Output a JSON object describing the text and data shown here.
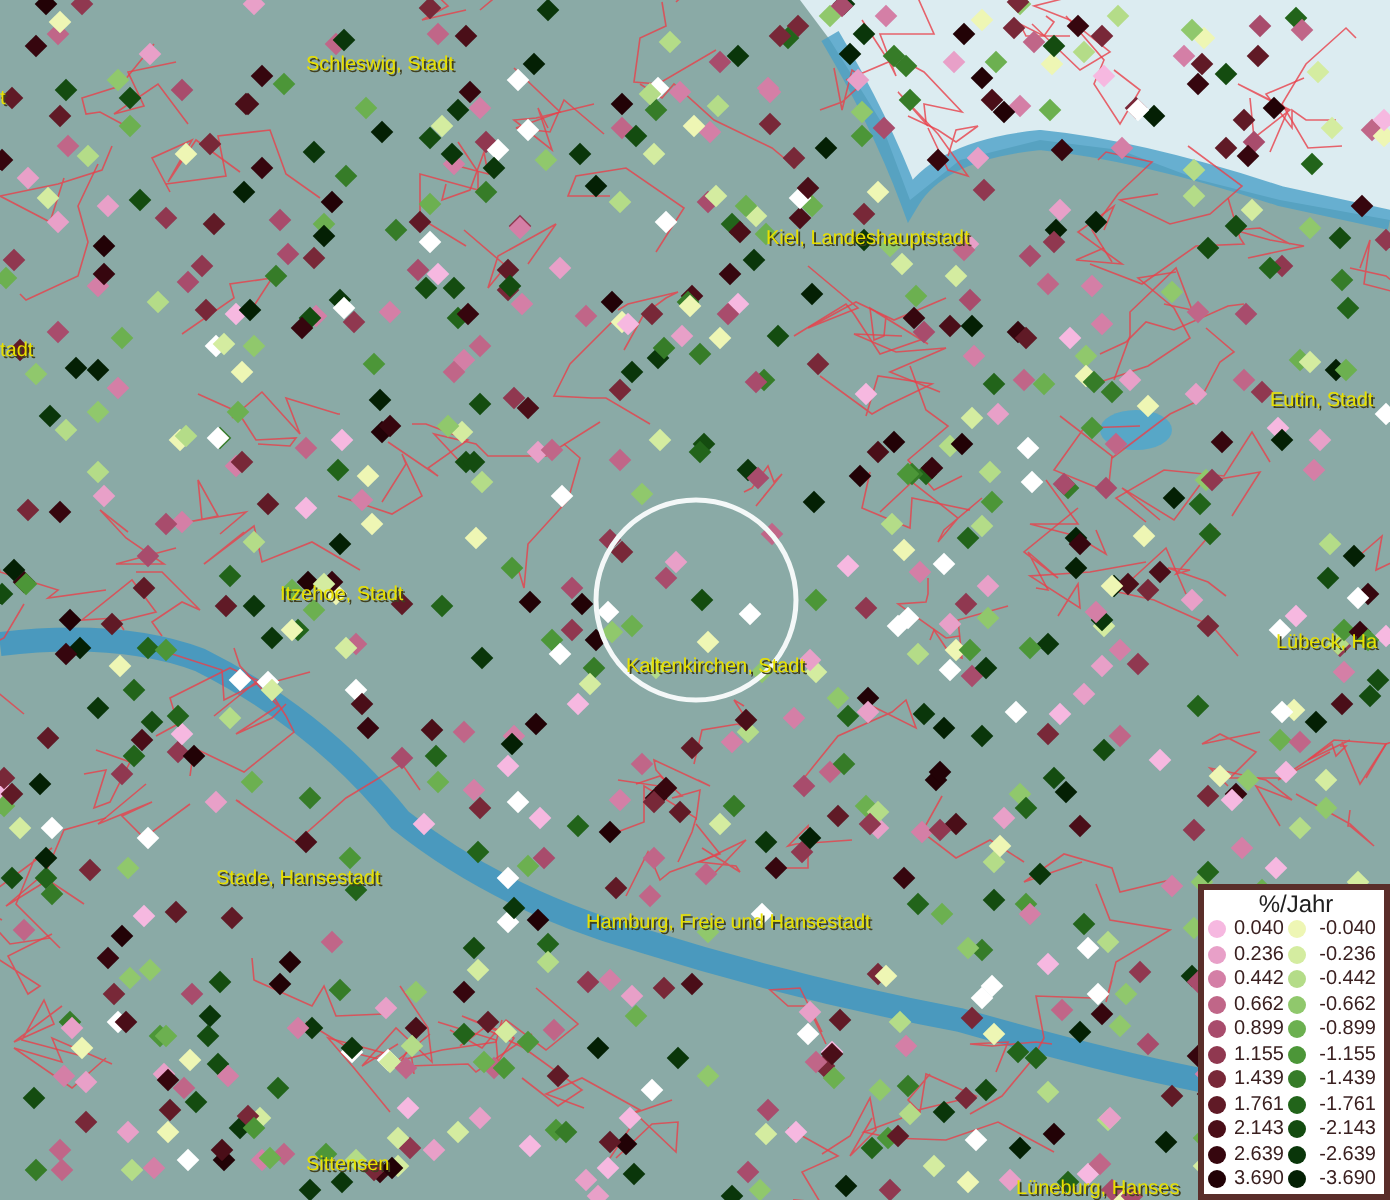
{
  "map": {
    "place_labels": [
      {
        "text": "Schleswig, Stadt"
      },
      {
        "text": "t"
      },
      {
        "text": "Kiel, Landeshauptstadt"
      },
      {
        "text": "tadt"
      },
      {
        "text": "Eutin, Stadt"
      },
      {
        "text": "Itzehoe, Stadt"
      },
      {
        "text": "Kaltenkirchen, Stadt"
      },
      {
        "text": "Lübeck, Ha"
      },
      {
        "text": "Stade, Hansestadt"
      },
      {
        "text": "Hamburg, Freie und Hansestadt"
      },
      {
        "text": "Sittensen"
      },
      {
        "text": "Lüneburg, Hanses"
      }
    ]
  },
  "legend": {
    "title": "%/Jahr",
    "positive": [
      {
        "value": "0.040",
        "color": "#f6b8e0"
      },
      {
        "value": "0.236",
        "color": "#e8a0c8"
      },
      {
        "value": "0.442",
        "color": "#d47fa6"
      },
      {
        "value": "0.662",
        "color": "#c06688"
      },
      {
        "value": "0.899",
        "color": "#a84c6c"
      },
      {
        "value": "1.155",
        "color": "#903850"
      },
      {
        "value": "1.439",
        "color": "#782838"
      },
      {
        "value": "1.761",
        "color": "#601a26"
      },
      {
        "value": "2.143",
        "color": "#4a0e18"
      },
      {
        "value": "2.639",
        "color": "#36060e"
      },
      {
        "value": "3.690",
        "color": "#220206"
      }
    ],
    "negative": [
      {
        "value": "-0.040",
        "color": "#eef6b4"
      },
      {
        "value": "-0.236",
        "color": "#d4eca0"
      },
      {
        "value": "-0.442",
        "color": "#b4dc88"
      },
      {
        "value": "-0.662",
        "color": "#90c86c"
      },
      {
        "value": "-0.899",
        "color": "#6cb050"
      },
      {
        "value": "-1.155",
        "color": "#4c9638"
      },
      {
        "value": "-1.439",
        "color": "#367c28"
      },
      {
        "value": "-1.761",
        "color": "#22641a"
      },
      {
        "value": "-2.143",
        "color": "#144c10"
      },
      {
        "value": "-2.639",
        "color": "#0a360a"
      },
      {
        "value": "-3.690",
        "color": "#042004"
      }
    ]
  }
}
